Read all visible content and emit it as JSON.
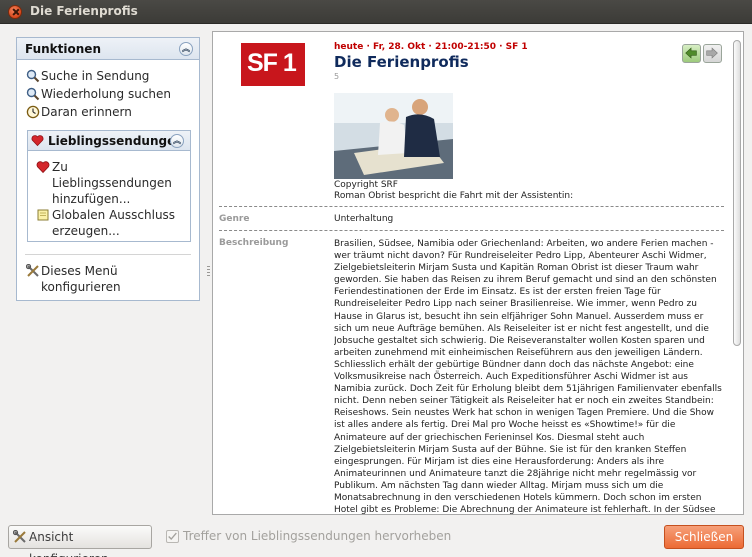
{
  "window": {
    "title": "Die Ferienprofis"
  },
  "functions": {
    "title": "Funktionen",
    "items": [
      {
        "label": "Suche in Sendung",
        "icon": "magnifier-icon"
      },
      {
        "label": "Wiederholung suchen",
        "icon": "magnifier-icon"
      },
      {
        "label": "Daran erinnern",
        "icon": "clock-icon"
      }
    ],
    "favorites": {
      "title": "Lieblingssendungen",
      "add_lines": [
        "Zu",
        "Lieblingssendungen",
        "hinzufügen..."
      ],
      "exclude_lines": [
        "Globalen Ausschluss",
        "erzeugen..."
      ]
    },
    "configure_lines": [
      "Dieses Menü",
      "konfigurieren"
    ]
  },
  "program": {
    "channel_logo": "SF 1",
    "air_info": "heute · Fr, 28. Okt · 21:00-21:50 · SF 1",
    "title": "Die Ferienprofis",
    "episode": "5",
    "photo_caption_lines": [
      "Copyright SRF",
      "Roman Obrist bespricht die Fahrt mit der Assistentin:"
    ],
    "genre_label": "Genre",
    "genre": "Unterhaltung",
    "description_label": "Beschreibung",
    "description": "Brasilien, Südsee, Namibia oder Griechenland: Arbeiten, wo andere Ferien machen - wer träumt nicht davon? Für Rundreiseleiter Pedro Lipp, Abenteurer Aschi Widmer, Zielgebietsleiterin Mirjam Susta und Kapitän Roman Obrist ist dieser Traum wahr geworden. Sie haben das Reisen zu ihrem Beruf gemacht und sind an den schönsten Feriendestinationen der Erde im Einsatz. Es ist der ersten freien Tage für Rundreiseleiter Pedro Lipp nach seiner Brasilienreise. Wie immer, wenn Pedro zu Hause in Glarus ist, besucht ihn sein elfjähriger Sohn Manuel. Ausserdem muss er sich um neue Aufträge bemühen. Als Reiseleiter ist er nicht fest angestellt, und die Jobsuche gestaltet sich schwierig. Die Reiseveranstalter wollen Kosten sparen und arbeiten zunehmend mit einheimischen Reiseführern aus den jeweiligen Ländern. Schliesslich erhält der gebürtige Bündner dann doch das nächste Angebot: eine Volksmusikreise nach Österreich. Auch Expeditionsführer Aschi Widmer ist aus Namibia zurück. Doch Zeit für Erholung bleibt dem 51jährigen Familienvater ebenfalls nicht. Denn neben seiner Tätigkeit als Reiseleiter hat er noch ein zweites Standbein: Reiseshows. Sein neustes Werk hat schon in wenigen Tagen Premiere. Und die Show ist alles andere als fertig. Drei Mal pro Woche heisst es «Showtime!» für die Animateure auf der griechischen Ferieninsel Kos. Diesmal steht auch Zielgebietsleiterin Mirjam Susta auf der Bühne. Sie ist für den kranken Steffen eingesprungen. Für Mirjam ist dies eine Herausforderung: Anders als ihre Animateurinnen und Animateure tanzt die 28jährige nicht mehr regelmässig vor Publikum. Am nächsten Tag dann wieder Alltag. Mirjam muss sich um die Monatsabrechnung in den verschiedenen Hotels kümmern. Doch schon im ersten Hotel gibt es Probleme: Die Abrechnung der Animateure ist fehlerhaft. In der Südsee hat Kapitän Roman Obrist ganz andere Sorgen. Eine Feuerwehrübung steht auf dem Tagesplan - und das bei laufendem Betrieb auf hoher See. Daneben ist erneut ein"
  },
  "bottom": {
    "configure_view_label": "Ansicht konfigurieren",
    "highlight_checkbox_label": "Treffer von Lieblingssendungen hervorheben",
    "highlight_checked": true,
    "close_label": "Schließen"
  },
  "colors": {
    "accent": "#ec6a34",
    "air_info": "#c00000",
    "title": "#0f2a5c",
    "logo": "#c8161c"
  }
}
